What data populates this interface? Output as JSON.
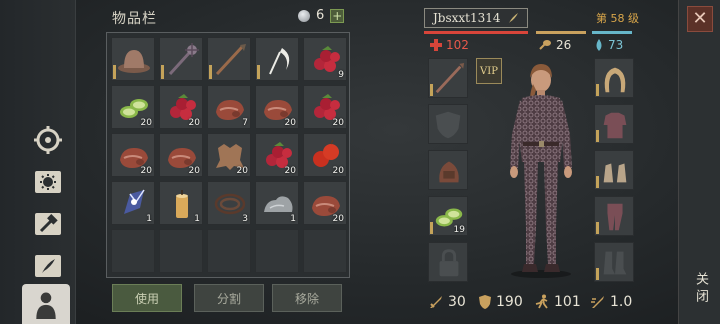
{
  "inventory": {
    "title": "物品栏",
    "currency": "6",
    "add_symbol": "+",
    "slots": [
      {
        "icon": "leather-hat-icon",
        "count": ""
      },
      {
        "icon": "spiked-mace-icon",
        "count": ""
      },
      {
        "icon": "wooden-spear-icon",
        "count": ""
      },
      {
        "icon": "bone-sickle-icon",
        "count": ""
      },
      {
        "icon": "red-berries-icon",
        "count": "9"
      },
      {
        "icon": "cucumber-slices-icon",
        "count": "20"
      },
      {
        "icon": "red-berries-icon",
        "count": "20"
      },
      {
        "icon": "raw-meat-icon",
        "count": "7"
      },
      {
        "icon": "raw-meat-icon",
        "count": "20"
      },
      {
        "icon": "red-berries-icon",
        "count": "20"
      },
      {
        "icon": "raw-meat-icon",
        "count": "20"
      },
      {
        "icon": "raw-meat-icon",
        "count": "20"
      },
      {
        "icon": "animal-hide-icon",
        "count": "20"
      },
      {
        "icon": "red-berries-icon",
        "count": "20"
      },
      {
        "icon": "red-apples-icon",
        "count": "20"
      },
      {
        "icon": "crystal-shard-icon",
        "count": "1"
      },
      {
        "icon": "wax-candle-icon",
        "count": "1"
      },
      {
        "icon": "rope-icon",
        "count": "3"
      },
      {
        "icon": "stone-icon",
        "count": "1"
      },
      {
        "icon": "raw-meat-icon",
        "count": "20"
      }
    ],
    "actions": {
      "use": "使用",
      "split": "分割",
      "remove": "移除"
    }
  },
  "character": {
    "name": "Jbsxxt1314",
    "level": "第 58 级",
    "health": "102",
    "hunger": "26",
    "thirst": "73",
    "left_equipment": [
      {
        "icon": "spear-slot-icon",
        "count": ""
      },
      {
        "icon": "shield-slot-icon",
        "count": ""
      },
      {
        "icon": "backpack-icon",
        "count": ""
      },
      {
        "icon": "cucumber-slices-icon",
        "count": "19"
      },
      {
        "icon": "lock-icon",
        "count": ""
      }
    ],
    "right_equipment": [
      {
        "icon": "hood-icon"
      },
      {
        "icon": "chainmail-shirt-icon"
      },
      {
        "icon": "gloves-icon"
      },
      {
        "icon": "leggings-icon"
      },
      {
        "icon": "boots-icon"
      }
    ],
    "vip": "VIP",
    "stats": {
      "attack": "30",
      "armor": "190",
      "speed": "101",
      "attack_speed": "1.0"
    }
  },
  "close_label": "关闭",
  "colors": {
    "health": "#d8453a",
    "hunger": "#c9a15e",
    "thirst": "#67b6c9",
    "level": "#d9a64a"
  }
}
